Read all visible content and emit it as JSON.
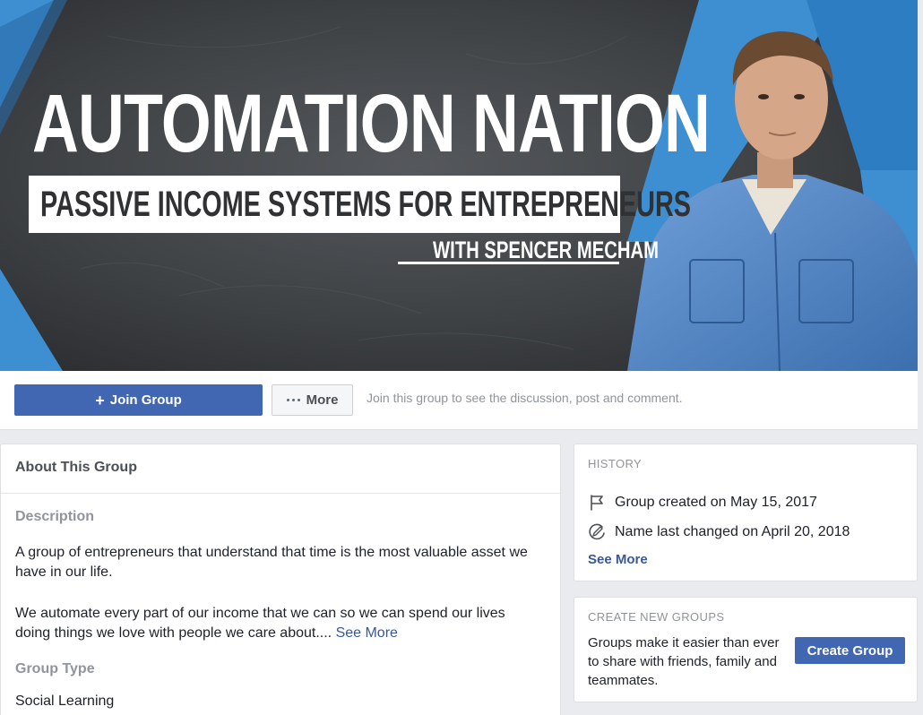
{
  "cover": {
    "title": "AUTOMATION NATION",
    "subtitle": "PASSIVE INCOME SYSTEMS FOR ENTREPRENEURS",
    "byline": "WITH SPENCER MECHAM"
  },
  "actions": {
    "join_label": "Join Group",
    "join_icon": "plus-icon",
    "more_label": "More",
    "more_icon": "ellipsis-icon",
    "hint": "Join this group to see the discussion, post and comment."
  },
  "about": {
    "heading": "About This Group",
    "description_label": "Description",
    "description_p1": "A group of entrepreneurs that understand that time is the most valuable asset we have in our life.",
    "description_p2": "We automate every part of our income that we can so we can spend our lives doing things we love with people we care about.... ",
    "see_more": "See More",
    "type_label": "Group Type",
    "type_value": "Social Learning"
  },
  "history": {
    "heading": "HISTORY",
    "created": "Group created on May 15, 2017",
    "created_icon": "flag-icon",
    "renamed": "Name last changed on April 20, 2018",
    "renamed_icon": "pencil-icon",
    "see_more": "See More"
  },
  "create_groups": {
    "heading": "CREATE NEW GROUPS",
    "text": "Groups make it easier than ever to share with friends, family and teammates.",
    "button_label": "Create Group"
  },
  "colors": {
    "facebook_blue": "#4267b2",
    "link_blue": "#385898",
    "page_bg": "#e9ebee",
    "cover_accent": "#3d8fd1"
  }
}
